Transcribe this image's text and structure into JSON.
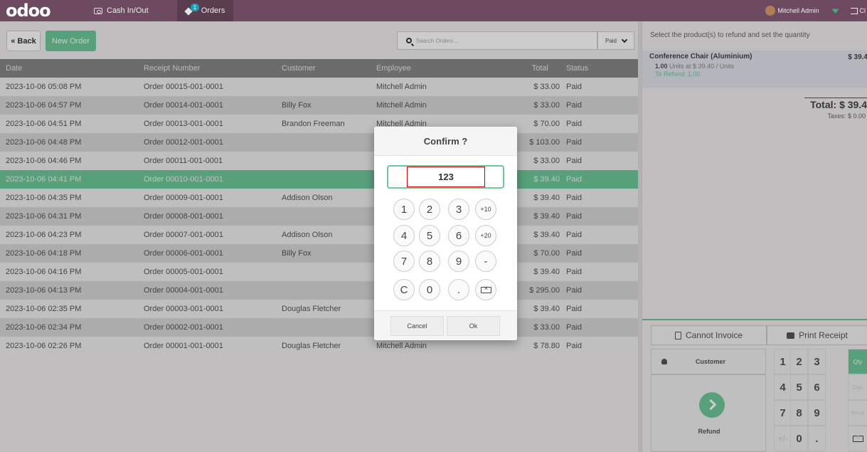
{
  "topbar": {
    "logo": "odoo",
    "cash_label": "Cash In/Out",
    "orders_label": "Orders",
    "orders_badge": "1",
    "user_name": "Mitchell Admin",
    "close_label": "Cl"
  },
  "controls": {
    "back_label": "« Back",
    "new_order_label": "New Order",
    "search_placeholder": "Search Orders...",
    "filter_label": "Paid"
  },
  "table": {
    "headers": [
      "Date",
      "Receipt Number",
      "Customer",
      "Employee",
      "Total",
      "Status"
    ],
    "rows": [
      {
        "date": "2023-10-06 05:08 PM",
        "receipt": "Order 00015-001-0001",
        "customer": "",
        "employee": "Mitchell Admin",
        "total": "$ 33.00",
        "status": "Paid"
      },
      {
        "date": "2023-10-06 04:57 PM",
        "receipt": "Order 00014-001-0001",
        "customer": "Billy Fox",
        "employee": "Mitchell Admin",
        "total": "$ 33.00",
        "status": "Paid"
      },
      {
        "date": "2023-10-06 04:51 PM",
        "receipt": "Order 00013-001-0001",
        "customer": "Brandon Freeman",
        "employee": "Mitchell Admin",
        "total": "$ 70.00",
        "status": "Paid"
      },
      {
        "date": "2023-10-06 04:48 PM",
        "receipt": "Order 00012-001-0001",
        "customer": "",
        "employee": "",
        "total": "$ 103.00",
        "status": "Paid"
      },
      {
        "date": "2023-10-06 04:46 PM",
        "receipt": "Order 00011-001-0001",
        "customer": "",
        "employee": "",
        "total": "$ 33.00",
        "status": "Paid"
      },
      {
        "date": "2023-10-06 04:41 PM",
        "receipt": "Order 00010-001-0001",
        "customer": "",
        "employee": "",
        "total": "$ 39.40",
        "status": "Paid"
      },
      {
        "date": "2023-10-06 04:35 PM",
        "receipt": "Order 00009-001-0001",
        "customer": "Addison Olson",
        "employee": "",
        "total": "$ 39.40",
        "status": "Paid"
      },
      {
        "date": "2023-10-06 04:31 PM",
        "receipt": "Order 00008-001-0001",
        "customer": "",
        "employee": "",
        "total": "$ 39.40",
        "status": "Paid"
      },
      {
        "date": "2023-10-06 04:23 PM",
        "receipt": "Order 00007-001-0001",
        "customer": "Addison Olson",
        "employee": "",
        "total": "$ 39.40",
        "status": "Paid"
      },
      {
        "date": "2023-10-06 04:18 PM",
        "receipt": "Order 00006-001-0001",
        "customer": "Billy Fox",
        "employee": "",
        "total": "$ 70.00",
        "status": "Paid"
      },
      {
        "date": "2023-10-06 04:16 PM",
        "receipt": "Order 00005-001-0001",
        "customer": "",
        "employee": "",
        "total": "$ 39.40",
        "status": "Paid"
      },
      {
        "date": "2023-10-06 04:13 PM",
        "receipt": "Order 00004-001-0001",
        "customer": "",
        "employee": "",
        "total": "$ 295.00",
        "status": "Paid"
      },
      {
        "date": "2023-10-06 02:35 PM",
        "receipt": "Order 00003-001-0001",
        "customer": "Douglas Fletcher",
        "employee": "",
        "total": "$ 39.40",
        "status": "Paid"
      },
      {
        "date": "2023-10-06 02:34 PM",
        "receipt": "Order 00002-001-0001",
        "customer": "",
        "employee": "",
        "total": "$ 33.00",
        "status": "Paid"
      },
      {
        "date": "2023-10-06 02:26 PM",
        "receipt": "Order 00001-001-0001",
        "customer": "Douglas Fletcher",
        "employee": "Mitchell Admin",
        "total": "$ 78.80",
        "status": "Paid"
      }
    ]
  },
  "refund": {
    "message": "Select the product(s) to refund and set the quantity",
    "product": "Conference Chair (Aluminium)",
    "price": "$ 39.4",
    "qty": "1.00",
    "unit_info": "Units at $ 39.40 / Units",
    "to_refund": "To Refund: 1.00",
    "total": "Total: $ 39.4",
    "taxes": "Taxes: $ 0.00",
    "cannot_invoice": "Cannot Invoice",
    "print_receipt": "Print Receipt",
    "customer_label": "Customer",
    "refund_label": "Refund",
    "numpad": [
      "1",
      "2",
      "3",
      "4",
      "5",
      "6",
      "7",
      "8",
      "9",
      "+/-",
      "0",
      "."
    ],
    "modes": [
      "Qty",
      "Disc",
      "Price"
    ]
  },
  "dialog": {
    "title": "Confirm ?",
    "value": "123",
    "keys": [
      "1",
      "2",
      "3",
      "+10",
      "4",
      "5",
      "6",
      "+20",
      "7",
      "8",
      "9",
      "-",
      "C",
      "0",
      "."
    ],
    "cancel_label": "Cancel",
    "ok_label": "Ok"
  },
  "colors": {
    "topbar": "#6d4a5f",
    "accent": "#6ec89b"
  }
}
